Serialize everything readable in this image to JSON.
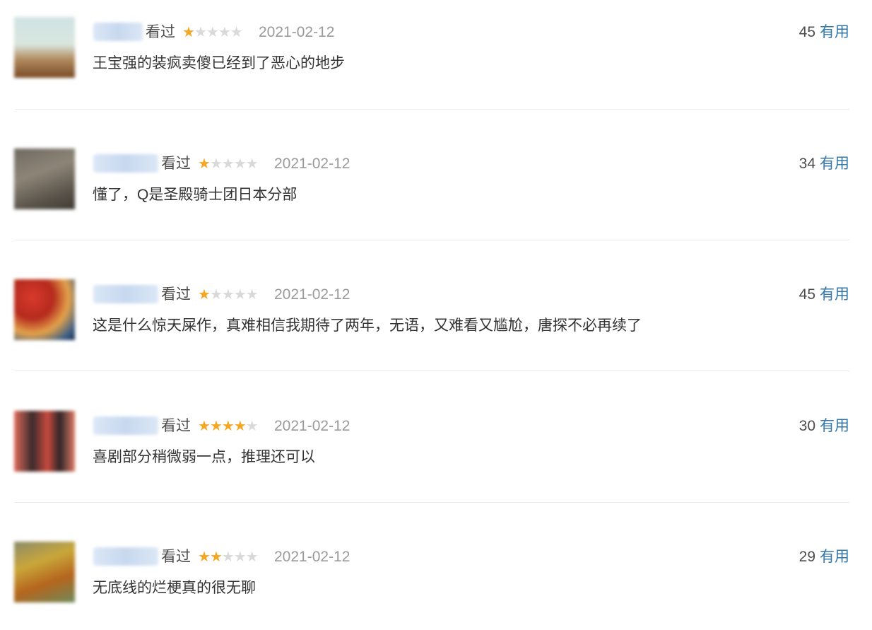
{
  "comments": [
    {
      "status": "看过",
      "rating": 1,
      "date": "2021-02-12",
      "votes": "45",
      "useful_label": "有用",
      "text": "王宝强的装疯卖傻已经到了恶心的地步"
    },
    {
      "status": "看过",
      "rating": 1,
      "date": "2021-02-12",
      "votes": "34",
      "useful_label": "有用",
      "text": "懂了，Q是圣殿骑士团日本分部"
    },
    {
      "status": "看过",
      "rating": 1,
      "date": "2021-02-12",
      "votes": "45",
      "useful_label": "有用",
      "text": "这是什么惊天屎作，真难相信我期待了两年，无语，又难看又尴尬，唐探不必再续了"
    },
    {
      "status": "看过",
      "rating": 4,
      "date": "2021-02-12",
      "votes": "30",
      "useful_label": "有用",
      "text": "喜剧部分稍微弱一点，推理还可以"
    },
    {
      "status": "看过",
      "rating": 2,
      "date": "2021-02-12",
      "votes": "29",
      "useful_label": "有用",
      "text": "无底线的烂梗真的很无聊"
    }
  ],
  "colors": {
    "star_on": "#f5a623",
    "star_off": "#d9d9d9",
    "link": "#3377aa"
  },
  "icons": {
    "star": "star-icon"
  }
}
